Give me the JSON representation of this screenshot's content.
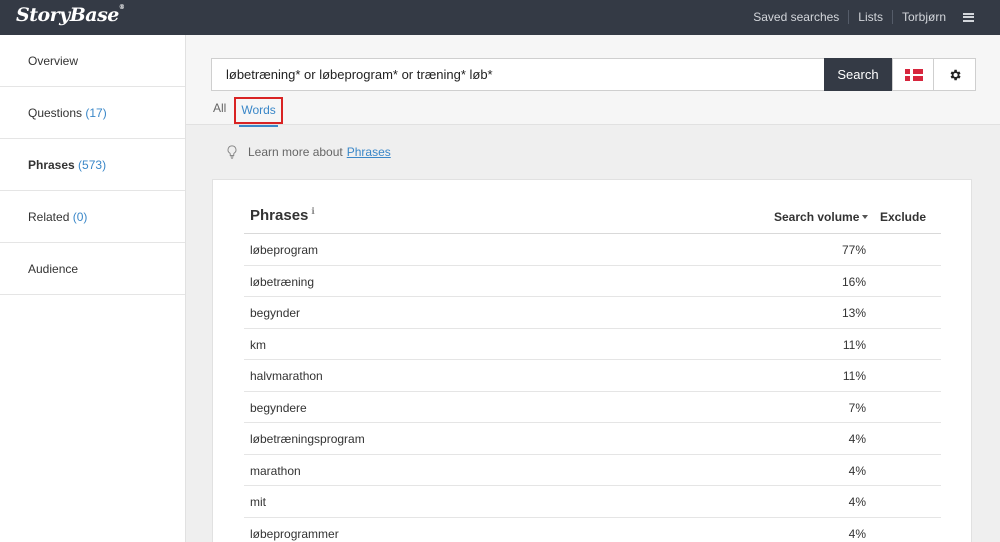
{
  "brand": {
    "logo": "StoryBase"
  },
  "nav": {
    "saved_searches": "Saved searches",
    "lists": "Lists",
    "user": "Torbjørn"
  },
  "sidebar": {
    "items": [
      {
        "label": "Overview",
        "count": ""
      },
      {
        "label": "Questions",
        "count": "(17)"
      },
      {
        "label": "Phrases",
        "count": "(573)"
      },
      {
        "label": "Related",
        "count": "(0)"
      },
      {
        "label": "Audience",
        "count": ""
      }
    ]
  },
  "search": {
    "value": "løbetræning* or løbeprogram* or træning* løb*",
    "button": "Search",
    "language_flag": "flag-denmark-icon"
  },
  "tabs": [
    {
      "label": "All"
    },
    {
      "label": "Words"
    }
  ],
  "learn": {
    "text": "Learn more about",
    "link": "Phrases"
  },
  "table": {
    "title": "Phrases",
    "info_icon": "ℹ",
    "col_search_volume": "Search volume",
    "col_exclude": "Exclude",
    "rows": [
      {
        "word": "løbeprogram",
        "pct": "77%"
      },
      {
        "word": "løbetræning",
        "pct": "16%"
      },
      {
        "word": "begynder",
        "pct": "13%"
      },
      {
        "word": "km",
        "pct": "11%"
      },
      {
        "word": "halvmarathon",
        "pct": "11%"
      },
      {
        "word": "begyndere",
        "pct": "7%"
      },
      {
        "word": "løbetræningsprogram",
        "pct": "4%"
      },
      {
        "word": "marathon",
        "pct": "4%"
      },
      {
        "word": "mit",
        "pct": "4%"
      },
      {
        "word": "løbeprogrammer",
        "pct": "4%"
      }
    ]
  },
  "colors": {
    "topbar": "#343a45",
    "link": "#3a87c8",
    "highlight": "#d92323"
  }
}
